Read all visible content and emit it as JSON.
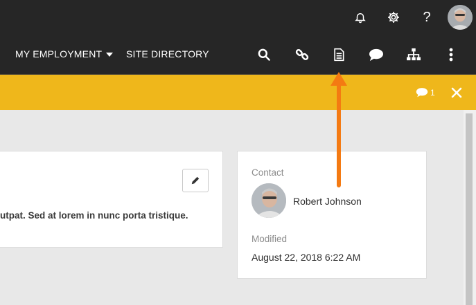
{
  "header": {
    "icons": [
      "bell-icon",
      "gear-icon",
      "help-icon"
    ],
    "help_glyph": "?"
  },
  "nav": {
    "my_employment": "MY EMPLOYMENT",
    "site_directory": "SITE DIRECTORY",
    "icons": [
      "search-icon",
      "link-icon",
      "document-icon",
      "chat-icon",
      "sitemap-icon",
      "more-vertical-icon"
    ]
  },
  "notification": {
    "comment_count": "1",
    "background": "#efb71b"
  },
  "content": {
    "body_text": "utpat. Sed at lorem in nunc porta tristique."
  },
  "details": {
    "contact_label": "Contact",
    "contact_name": "Robert Johnson",
    "modified_label": "Modified",
    "modified_value": "August 22, 2018 6:22 AM"
  },
  "annotation": {
    "arrow_color": "#f47a12"
  }
}
